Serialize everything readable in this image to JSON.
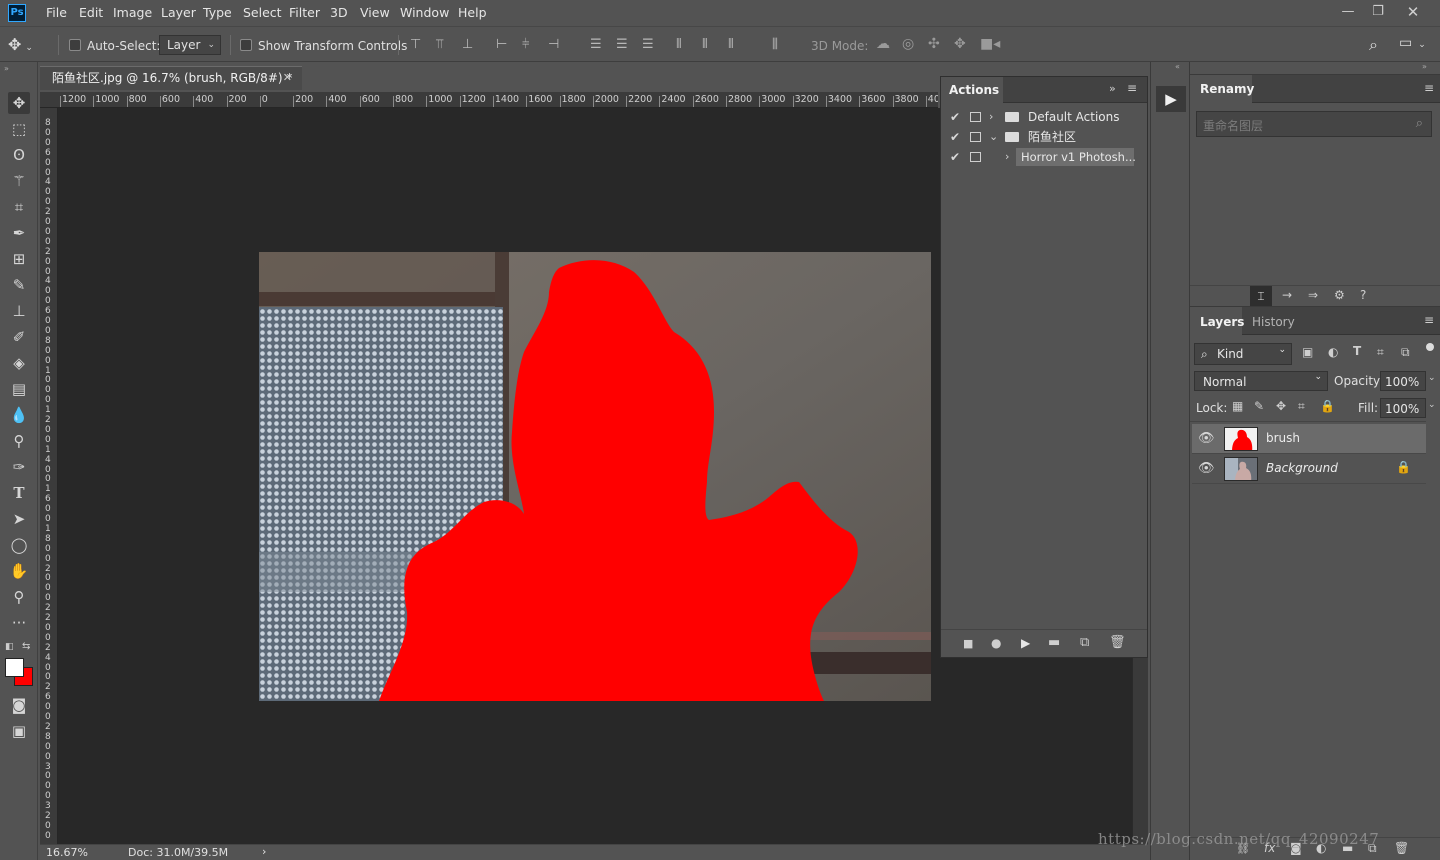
{
  "menubar": {
    "app_icon": "Ps",
    "items": [
      "File",
      "Edit",
      "Image",
      "Layer",
      "Type",
      "Select",
      "Filter",
      "3D",
      "View",
      "Window",
      "Help"
    ],
    "window_controls": [
      "minimize-icon",
      "restore-icon",
      "close-icon"
    ]
  },
  "options": {
    "auto_select_label": "Auto-Select:",
    "auto_select_value": "Layer",
    "show_transform_label": "Show Transform Controls",
    "mode_label": "3D Mode:"
  },
  "document": {
    "tab_title": "陌鱼社区.jpg @ 16.7% (brush, RGB/8#) *",
    "ruler_h": [
      "1200",
      "1000",
      "800",
      "600",
      "400",
      "200",
      "0",
      "200",
      "400",
      "600",
      "800",
      "1000",
      "1200",
      "1400",
      "1600",
      "1800",
      "2000",
      "2200",
      "2400",
      "2600",
      "2800",
      "3000",
      "3200",
      "3400",
      "3600",
      "3800",
      "40"
    ],
    "ruler_v": [
      "8",
      "0",
      "0",
      "6",
      "0",
      "0",
      "4",
      "0",
      "0",
      "2",
      "0",
      "0",
      "0",
      "2",
      "0",
      "0",
      "4",
      "0",
      "0",
      "6",
      "0",
      "0",
      "8",
      "0",
      "0",
      "1",
      "0",
      "0",
      "0",
      "1",
      "2",
      "0",
      "0",
      "1",
      "4",
      "0",
      "0",
      "1",
      "6",
      "0",
      "0",
      "1",
      "8",
      "0",
      "0",
      "2",
      "0",
      "0",
      "0",
      "2",
      "2",
      "0",
      "0",
      "2",
      "4",
      "0",
      "0",
      "2",
      "6",
      "0",
      "0",
      "2",
      "8",
      "0",
      "0",
      "3",
      "0",
      "0",
      "0",
      "3",
      "2",
      "0",
      "0"
    ],
    "zoom": "16.67%",
    "doc_size": "Doc: 31.0M/39.5M",
    "fill_color": "#ff0000"
  },
  "actions": {
    "tab_label": "Actions",
    "items": [
      {
        "label": "Default Actions"
      },
      {
        "label": "陌鱼社区"
      },
      {
        "label": "Horror v1 Photosh..."
      }
    ]
  },
  "renamy": {
    "tab_label": "Renamy",
    "search_placeholder": "重命名图层"
  },
  "layers": {
    "tabs": [
      "Layers",
      "History"
    ],
    "kind_label": "Kind",
    "blend_mode": "Normal",
    "opacity_label": "Opacity:",
    "opacity_value": "100%",
    "lock_label": "Lock:",
    "fill_label": "Fill:",
    "fill_value": "100%",
    "items": [
      {
        "name": "brush",
        "selected": true
      },
      {
        "name": "Background",
        "locked": true
      }
    ]
  },
  "watermark": "https://blog.csdn.net/qq_42090247",
  "colors": {
    "foreground": "#ffffff",
    "background": "#ff0000"
  }
}
